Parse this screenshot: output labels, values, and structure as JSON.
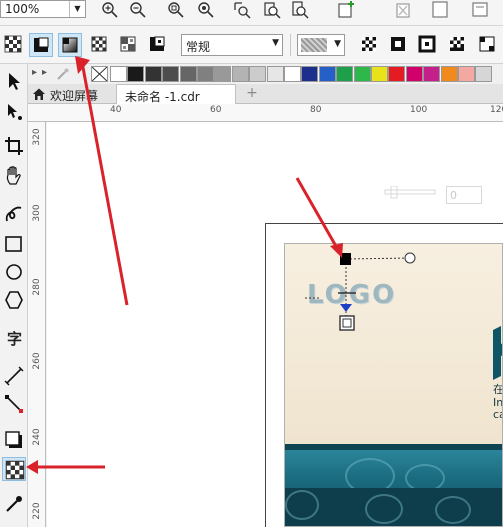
{
  "toolbar": {
    "zoom_value": "100%"
  },
  "property_bar": {
    "transparency_mode": "常规"
  },
  "tabs": {
    "welcome_label": "欢迎屏幕",
    "document_label": "未命名 -1.cdr",
    "add_label": "+"
  },
  "toolbox": {
    "text_tool_label": "字"
  },
  "ruler": {
    "h_ticks": [
      "40",
      "60",
      "80",
      "100",
      "120"
    ],
    "v_ticks": [
      "300",
      "280",
      "260",
      "240",
      "220"
    ],
    "v_small_ticks": [
      "320"
    ]
  },
  "artwork": {
    "logo_text": "LOGO",
    "side_text_1": "在",
    "side_text_2": "In",
    "side_text_3": "ca"
  },
  "transparency": {
    "value": "0"
  },
  "palette_colors": [
    "#ffffff",
    "#1a1a1a",
    "#333333",
    "#4d4d4d",
    "#666666",
    "#808080",
    "#999999",
    "#b3b3b3",
    "#cccccc",
    "#e6e6e6",
    "#ffffff",
    "#1c2f8c",
    "#2560c8",
    "#1ea04a",
    "#2eb84c",
    "#e8e21a",
    "#e31b23",
    "#d2006b",
    "#c51f8b",
    "#f08a1d",
    "#f3a9a1",
    "#d6d6d6"
  ],
  "colors": {
    "accent_selection": "#cfe6f7",
    "annotation_arrow": "#d9222a"
  }
}
